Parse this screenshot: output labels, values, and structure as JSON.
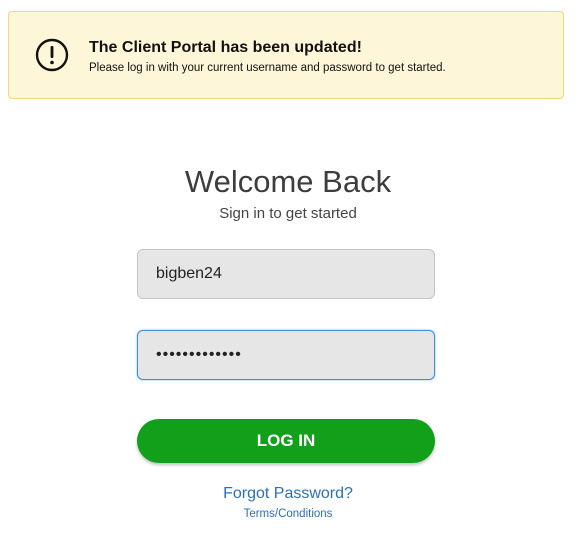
{
  "banner": {
    "icon": "exclamation-circle-icon",
    "title": "The Client Portal has been updated!",
    "message": "Please log in with your current username and password to get started.",
    "background_color": "#fdf6d8",
    "border_color": "#f2d57e"
  },
  "login": {
    "heading": "Welcome Back",
    "subheading": "Sign in to get started",
    "username_value": "bigben24",
    "password_value": "•••••••••••••",
    "button_label": "LOG IN",
    "button_color": "#12a01a",
    "forgot_password_label": "Forgot Password?",
    "terms_label": "Terms/Conditions",
    "link_color": "#2a6fbd"
  }
}
